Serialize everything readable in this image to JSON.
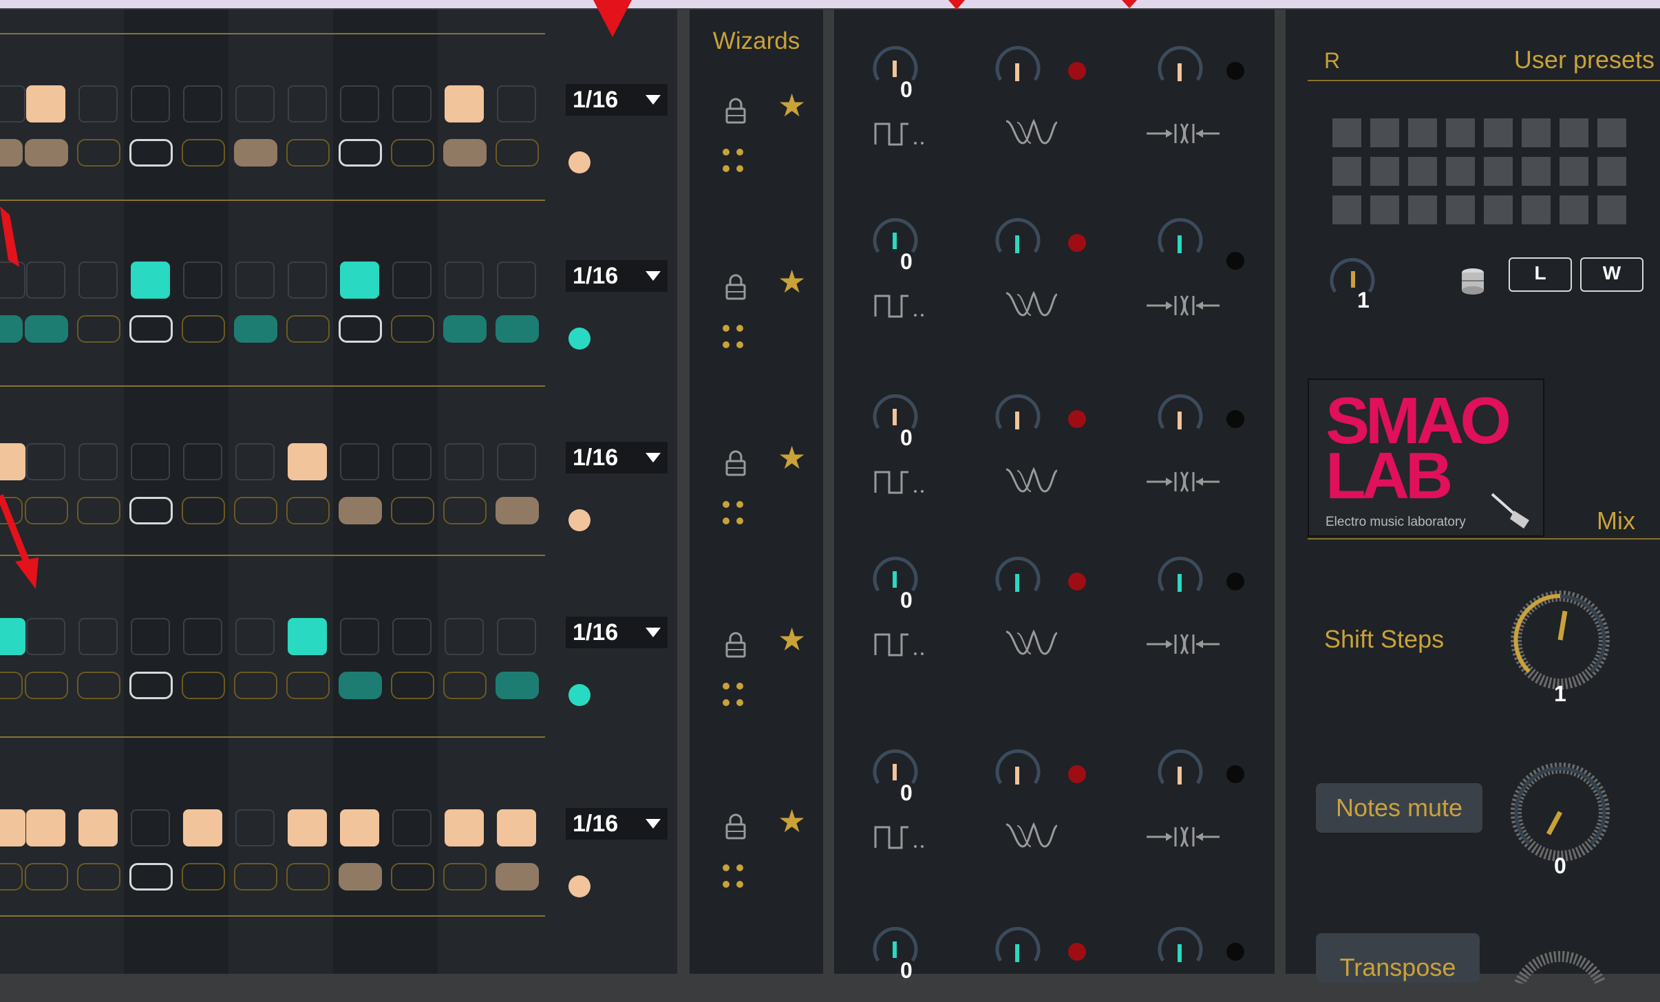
{
  "colors": {
    "peach": "#f2c49b",
    "peach_dim": "#917a63",
    "teal": "#2ad9c1",
    "teal_dim": "#1d7d72",
    "gold": "#c9a23a",
    "red_dot": "#9e0d14",
    "smao_pink": "#e0105a"
  },
  "sequencer": {
    "rows": [
      {
        "division": "1/16",
        "color": "peach",
        "big": [
          0,
          1,
          0,
          0,
          0,
          0,
          0,
          0,
          0,
          1,
          0
        ],
        "small": [
          "dim",
          "dim",
          "off",
          "white",
          "off",
          "dim",
          "off",
          "white",
          "off",
          "dim",
          "off"
        ]
      },
      {
        "division": "1/16",
        "color": "teal",
        "big": [
          0,
          0,
          0,
          1,
          0,
          0,
          0,
          1,
          0,
          0,
          0
        ],
        "small": [
          "dim",
          "dim",
          "off",
          "white",
          "off",
          "dim",
          "off",
          "white",
          "off",
          "dim",
          "dim"
        ]
      },
      {
        "division": "1/16",
        "color": "peach",
        "big": [
          1,
          0,
          0,
          0,
          0,
          0,
          1,
          0,
          0,
          0,
          0
        ],
        "small": [
          "off",
          "off",
          "off",
          "white",
          "off",
          "off",
          "off",
          "dim",
          "off",
          "off",
          "dim"
        ]
      },
      {
        "division": "1/16",
        "color": "teal",
        "big": [
          1,
          0,
          0,
          0,
          0,
          0,
          1,
          0,
          0,
          0,
          0
        ],
        "small": [
          "off",
          "off",
          "off",
          "white",
          "off",
          "off",
          "off",
          "dim",
          "off",
          "off",
          "dim"
        ]
      },
      {
        "division": "1/16",
        "color": "peach",
        "big": [
          1,
          1,
          1,
          0,
          1,
          0,
          1,
          1,
          0,
          1,
          1
        ],
        "small": [
          "off",
          "off",
          "off",
          "white",
          "off",
          "off",
          "off",
          "dim",
          "off",
          "off",
          "dim"
        ]
      }
    ]
  },
  "wizards": {
    "title": "Wizards",
    "rows": 5
  },
  "modulators": {
    "rows": [
      {
        "value": "0",
        "accent": "#f2c49b"
      },
      {
        "value": "0",
        "accent": "#2ad9c1"
      },
      {
        "value": "0",
        "accent": "#f2c49b"
      },
      {
        "value": "0",
        "accent": "#2ad9c1"
      },
      {
        "value": "0",
        "accent": "#f2c49b"
      },
      {
        "value": "0",
        "accent": "#2ad9c1"
      }
    ]
  },
  "presets": {
    "title": "User presets",
    "r_label": "R",
    "knob_value": "1",
    "load_label": "L",
    "write_label": "W",
    "logo_line1": "SMAO",
    "logo_line2": "LAB",
    "logo_tagline": "Electro music laboratory",
    "mix_label": "Mix",
    "shift_label": "Shift Steps",
    "shift_value": "1",
    "mute_label": "Notes mute",
    "mute_value": "0",
    "transpose_label": "Transpose"
  }
}
